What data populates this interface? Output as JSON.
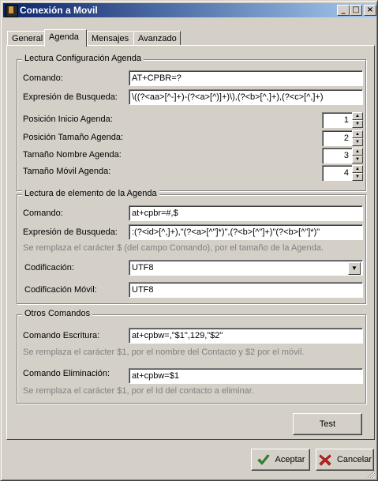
{
  "window": {
    "title": "Conexión a Movil",
    "minimize": "_",
    "maximize": "□",
    "close": "×"
  },
  "tabs": [
    {
      "label": "General",
      "active": false
    },
    {
      "label": "Agenda",
      "active": true
    },
    {
      "label": "Mensajes",
      "active": false
    },
    {
      "label": "Avanzado",
      "active": false
    }
  ],
  "config": {
    "legend": "Lectura Configuración Agenda",
    "comando_label": "Comando:",
    "comando_value": "AT+CPBR=?",
    "expresion_label": "Expresión de Busqueda:",
    "expresion_value": "\\((?<aa>[^-]+)-(?<a>[^)]+)\\),(?<b>[^,]+),(?<c>[^,]+)",
    "inicio_label": "Posición Inicio Agenda:",
    "inicio_value": "1",
    "tamano_label": "Posición Tamaño Agenda:",
    "tamano_value": "2",
    "nombre_label": "Tamaño Nombre Agenda:",
    "nombre_value": "3",
    "movil_label": "Tamaño Móvil Agenda:",
    "movil_value": "4"
  },
  "elemento": {
    "legend": "Lectura de elemento de la Agenda",
    "comando_label": "Comando:",
    "comando_value": "at+cpbr=#,$",
    "expresion_label": "Expresión de Busqueda:",
    "expresion_value": ":(?<id>[^,]+),\"(?<a>[^\"]*)\",(?<b>[^\"]+)\"(?<b>[^\"]*)\"",
    "hint": "Se remplaza el carácter $ (del campo Comando), por el tamaño de la Agenda.",
    "codificacion_label": "Codificación:",
    "codificacion_value": "UTF8",
    "codificacion_movil_label": "Codificación Móvil:",
    "codificacion_movil_value": "UTF8"
  },
  "otros": {
    "legend": "Otros Comandos",
    "escritura_label": "Comando Escritura:",
    "escritura_value": "at+cpbw=,\"$1\",129,\"$2\"",
    "escritura_hint": "Se remplaza el carácter $1, por el nombre del Contacto y $2 por el móvil.",
    "eliminacion_label": "Comando Eliminación:",
    "eliminacion_value": "at+cpbw=$1",
    "eliminacion_hint": "Se remplaza el carácter $1, por el Id del contacto a eliminar."
  },
  "buttons": {
    "test": "Test",
    "aceptar": "Aceptar",
    "cancelar": "Cancelar"
  },
  "colors": {
    "titlebar_start": "#0a246a",
    "titlebar_end": "#a6caf0",
    "face": "#d4d0c8",
    "hint": "#808080"
  }
}
